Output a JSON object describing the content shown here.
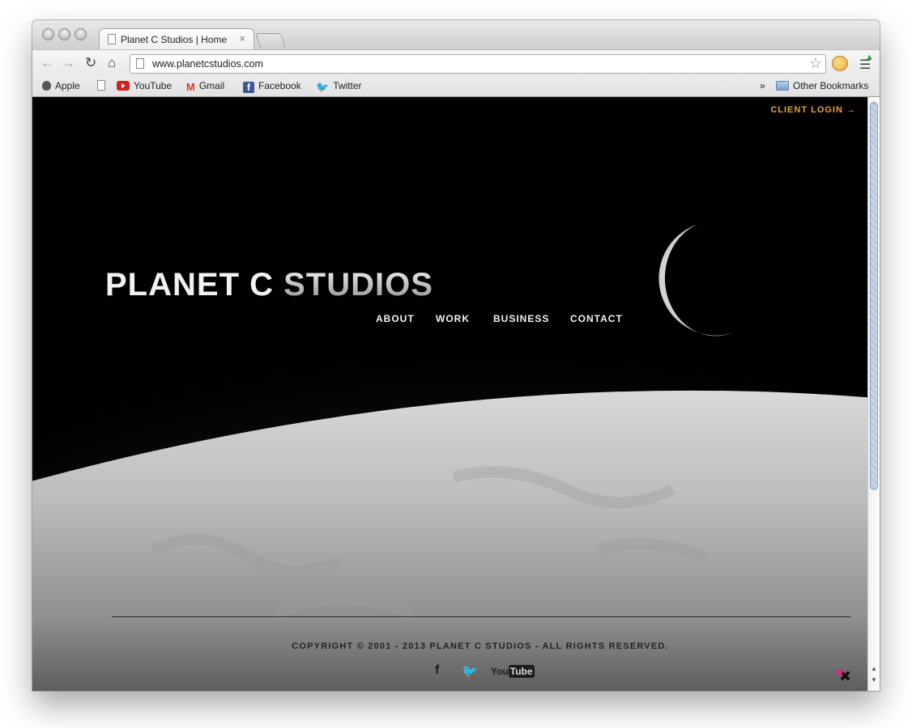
{
  "browser": {
    "tab_title": "Planet C Studios | Home",
    "tab_close": "×",
    "url": "www.planetcstudios.com",
    "bookmarks": [
      {
        "label": "Apple",
        "icon": "apple-icon"
      },
      {
        "label": "YouTube",
        "icon": "youtube-icon"
      },
      {
        "label": "Gmail",
        "icon": "gmail-icon"
      },
      {
        "label": "Facebook",
        "icon": "facebook-icon"
      },
      {
        "label": "Twitter",
        "icon": "twitter-icon"
      }
    ],
    "overflow": "»",
    "other_bookmarks": "Other Bookmarks"
  },
  "site": {
    "client_login": "CLIENT LOGIN →",
    "logo_part1": "PLANET C ",
    "logo_part2": "STUDIOS",
    "nav": [
      "ABOUT",
      "WORK",
      "BUSINESS",
      "CONTACT"
    ],
    "copyright": "COPYRIGHT © 2001 - 2013 PLANET C STUDIOS - ALL RIGHTS RESERVED.",
    "social": {
      "facebook": "f",
      "twitter": "🐦",
      "youtube_you": "You",
      "youtube_tube": "Tube"
    },
    "accent_color": "#e6a33a"
  }
}
